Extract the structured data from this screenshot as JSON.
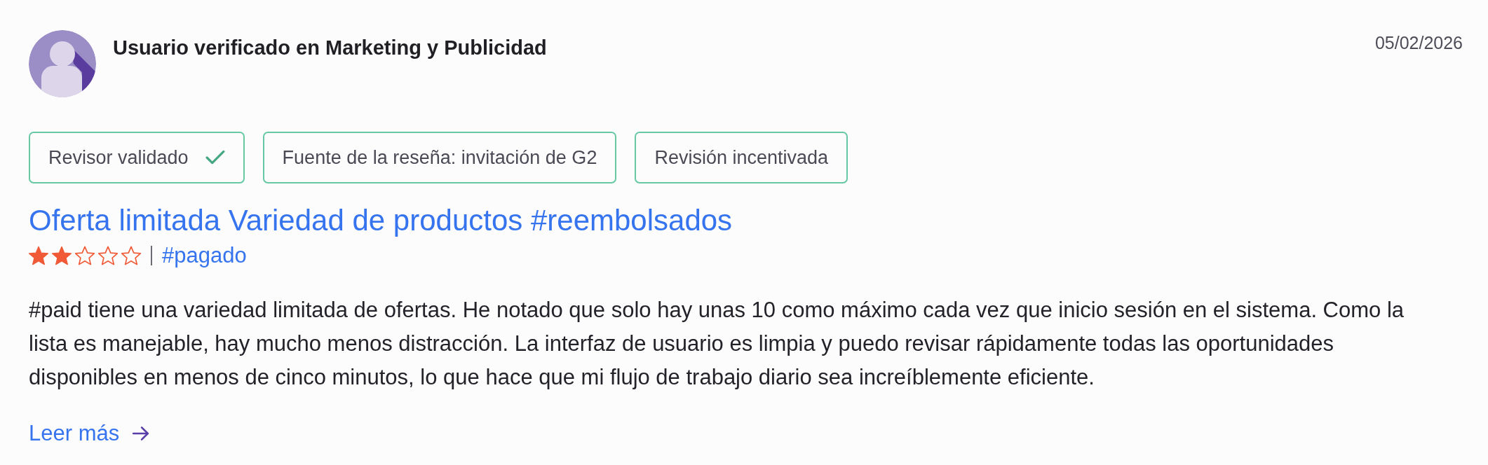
{
  "reviewer": {
    "title": "Usuario verificado en Marketing y Publicidad",
    "date": "05/02/2026"
  },
  "badges": [
    {
      "label": "Revisor validado",
      "verified": true
    },
    {
      "label": "Fuente de la reseña: invitación de G2",
      "verified": false
    },
    {
      "label": "Revisión incentivada",
      "verified": false
    }
  ],
  "review": {
    "title": "Oferta limitada Variedad de productos #reembolsados",
    "stars": 2,
    "tag": "#pagado",
    "body": "#paid tiene una variedad limitada de ofertas. He notado que solo hay unas 10 como máximo cada vez que inicio sesión en el sistema. Como la lista es manejable, hay mucho menos distracción. La interfaz de usuario es limpia y puedo revisar rápidamente todas las oportunidades disponibles en menos de cinco minutos, lo que hace que mi flujo de trabajo diario sea increíblemente eficiente.",
    "read_more": "Leer más"
  }
}
